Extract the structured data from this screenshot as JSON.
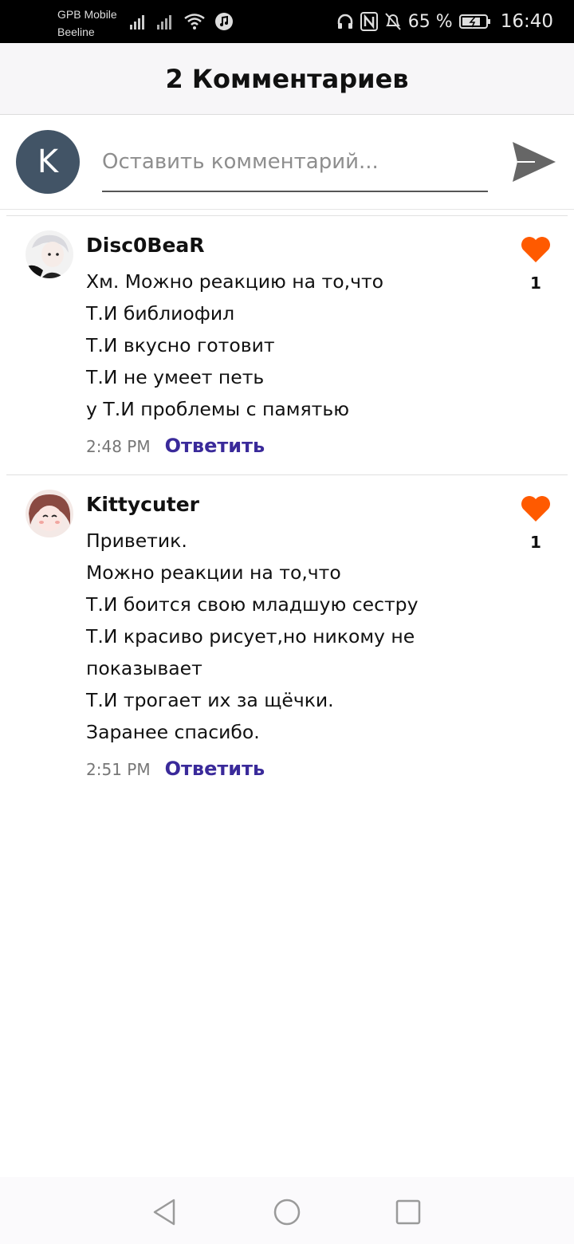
{
  "status_bar": {
    "carrier_1": "GPB Mobile",
    "carrier_2": "Beeline",
    "battery": "65 %",
    "time": "16:40"
  },
  "header": {
    "title": "2 Комментариев"
  },
  "composer": {
    "avatar_letter": "K",
    "placeholder": "Оставить комментарий..."
  },
  "colors": {
    "accent": "#ff5a00",
    "link": "#3a2a9a",
    "avatar_bg": "#425466"
  },
  "comments": [
    {
      "author": "Disc0BeaR",
      "lines": [
        "Хм. Можно реакцию на то,что",
        "Т.И библиофил",
        "Т.И вкусно готовит",
        "Т.И не умеет петь",
        "у Т.И проблемы с памятью"
      ],
      "time": "2:48 PM",
      "reply": "Ответить",
      "likes": "1"
    },
    {
      "author": "Kittycuter",
      "lines": [
        "Приветик.",
        "Можно реакции на то,что",
        "Т.И боится свою младшую сестру",
        "Т.И красиво рисует,но никому не",
        "показывает",
        "Т.И трогает их за щёчки.",
        "Заранее спасибо."
      ],
      "time": "2:51 PM",
      "reply": "Ответить",
      "likes": "1"
    }
  ]
}
